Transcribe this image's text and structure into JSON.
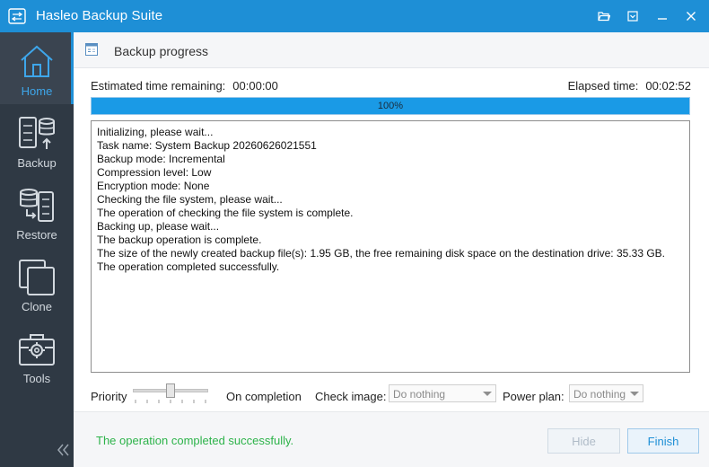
{
  "window": {
    "title": "Hasleo Backup Suite",
    "controls": [
      "folder-open-icon",
      "menu-dropdown-icon",
      "minimize-icon",
      "close-icon"
    ]
  },
  "sidebar": {
    "items": [
      {
        "label": "Home",
        "icon": "home-icon",
        "active": true
      },
      {
        "label": "Backup",
        "icon": "backup-icon",
        "active": false
      },
      {
        "label": "Restore",
        "icon": "restore-icon",
        "active": false
      },
      {
        "label": "Clone",
        "icon": "clone-icon",
        "active": false
      },
      {
        "label": "Tools",
        "icon": "tools-icon",
        "active": false
      }
    ],
    "collapse_icon": "double-chevron-left-icon"
  },
  "header": {
    "title": "Backup progress",
    "icon": "backup-progress-icon"
  },
  "progress": {
    "estimated_label": "Estimated time remaining:",
    "estimated_value": "00:00:00",
    "elapsed_label": "Elapsed time:",
    "elapsed_value": "00:02:52",
    "percent_text": "100%",
    "percent": 100
  },
  "log": [
    "Initializing, please wait...",
    "Task name: System Backup 20260626021551",
    "Backup mode: Incremental",
    "Compression level: Low",
    "Encryption mode: None",
    "Checking the file system, please wait...",
    "The operation of checking the file system is complete.",
    "Backing up, please wait...",
    "The backup operation is complete.",
    "The size of the newly created backup file(s): 1.95 GB, the free remaining disk space on the destination drive: 35.33 GB.",
    "The operation completed successfully."
  ],
  "options": {
    "priority_label": "Priority",
    "on_completion_label": "On completion",
    "check_image_label": "Check image:",
    "check_image_value": "Do nothing",
    "power_plan_label": "Power plan:",
    "power_plan_value": "Do nothing"
  },
  "footer": {
    "status_text": "The operation completed successfully.",
    "hide_label": "Hide",
    "finish_label": "Finish"
  },
  "colors": {
    "accent": "#1e8fd6",
    "sidebar_bg": "#2f3944",
    "status_success": "#2db34a"
  }
}
